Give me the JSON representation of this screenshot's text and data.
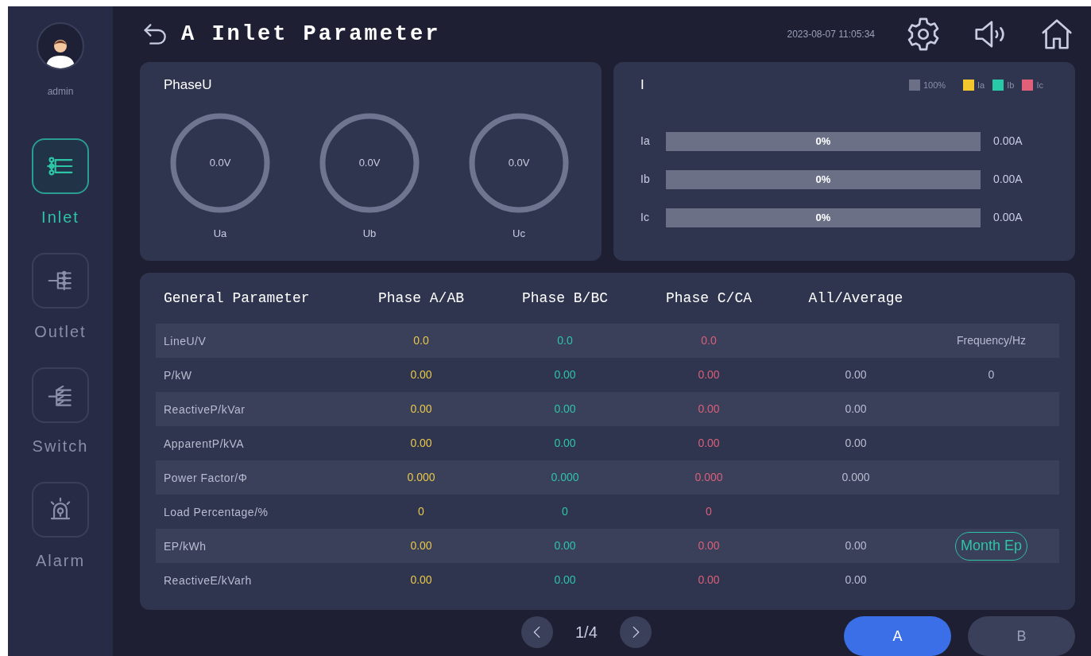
{
  "sidebar": {
    "user": "admin",
    "items": [
      {
        "label": "Inlet",
        "kind": "inlet",
        "selected": true
      },
      {
        "label": "Outlet",
        "kind": "outlet",
        "selected": false
      },
      {
        "label": "Switch",
        "kind": "switch",
        "selected": false
      },
      {
        "label": "Alarm",
        "kind": "alarm",
        "selected": false
      }
    ]
  },
  "header": {
    "title": "A Inlet Parameter",
    "datetime": "2023-08-07 11:05:34"
  },
  "voltage_card": {
    "title": "PhaseU",
    "gauges": [
      {
        "value": "0.0V",
        "label": "Ua"
      },
      {
        "value": "0.0V",
        "label": "Ub"
      },
      {
        "value": "0.0V",
        "label": "Uc"
      }
    ]
  },
  "current_card": {
    "title": "I",
    "legend": [
      {
        "label": "100%",
        "color": "#6b7087"
      },
      {
        "label": "Ia",
        "color": "#f2c62c"
      },
      {
        "label": "Ib",
        "color": "#27c9a8"
      },
      {
        "label": "Ic",
        "color": "#e0607a"
      }
    ],
    "bars": [
      {
        "label": "Ia",
        "percent": "0%",
        "reading": "0.00A"
      },
      {
        "label": "Ib",
        "percent": "0%",
        "reading": "0.00A"
      },
      {
        "label": "Ic",
        "percent": "0%",
        "reading": "0.00A"
      }
    ]
  },
  "table": {
    "columns": [
      {
        "label": "General Parameter"
      },
      {
        "label": "Phase A/AB",
        "color": "#e8c84a"
      },
      {
        "label": "Phase B/BC",
        "color": "#2ec4a6"
      },
      {
        "label": "Phase C/CA",
        "color": "#d9607a"
      },
      {
        "label": "All/Average"
      }
    ],
    "rows": [
      {
        "label": "LineU/V",
        "values": [
          "0.0",
          "0.0",
          "0.0"
        ],
        "extra": {
          "kind": "text",
          "text": "Frequency/Hz"
        }
      },
      {
        "label": "P/kW",
        "values": [
          "0.00",
          "0.00",
          "0.00"
        ],
        "average": "0.00",
        "extra": {
          "kind": "text",
          "text": "0"
        }
      },
      {
        "label": "ReactiveP/kVar",
        "values": [
          "0.00",
          "0.00",
          "0.00"
        ],
        "average": "0.00"
      },
      {
        "label": "ApparentP/kVA",
        "values": [
          "0.00",
          "0.00",
          "0.00"
        ],
        "average": "0.00"
      },
      {
        "label": "Power Factor/Φ",
        "values": [
          "0.000",
          "0.000",
          "0.000"
        ],
        "average": "0.000"
      },
      {
        "label": "Load Percentage/%",
        "values": [
          "0",
          "0",
          "0"
        ]
      },
      {
        "label": "EP/kWh",
        "values": [
          "0.00",
          "0.00",
          "0.00"
        ],
        "average": "0.00",
        "extra": {
          "kind": "button",
          "text": "Month Ep"
        }
      },
      {
        "label": "ReactiveE/kVarh",
        "values": [
          "0.00",
          "0.00",
          "0.00"
        ],
        "average": "0.00"
      }
    ]
  },
  "pagination": {
    "page": "1/4"
  },
  "phase_buttons": [
    {
      "label": "A",
      "selected": true
    },
    {
      "label": "B",
      "selected": false
    }
  ]
}
